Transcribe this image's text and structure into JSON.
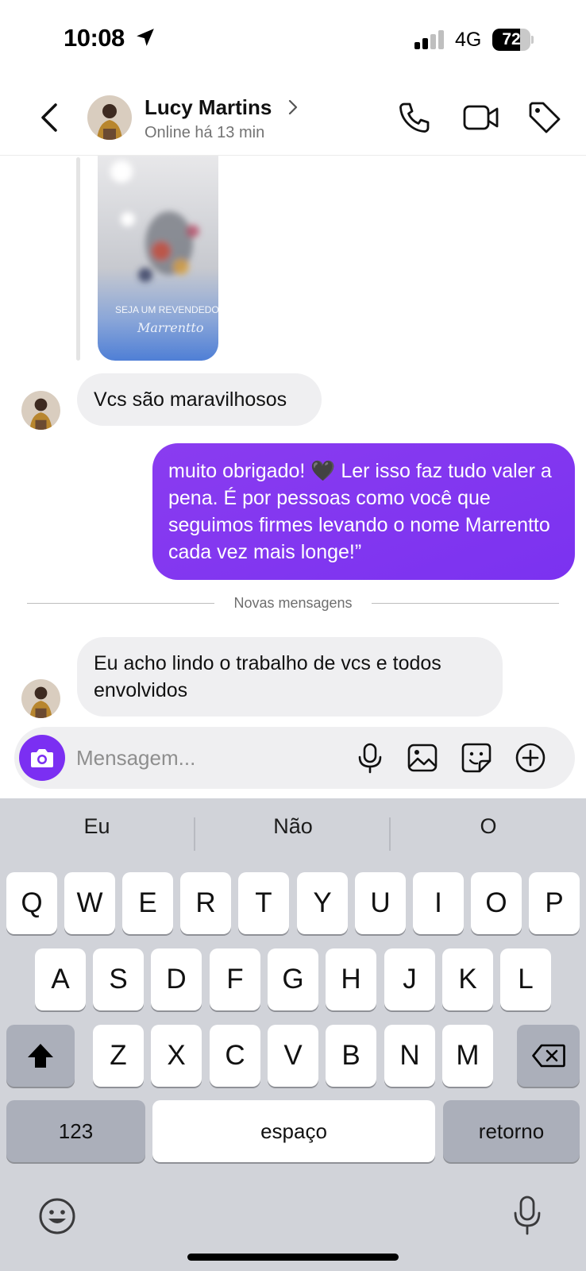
{
  "status_bar": {
    "time": "10:08",
    "network": "4G",
    "battery": "72",
    "battery_level": 0.72
  },
  "header": {
    "contact_name": "Lucy Martins",
    "contact_status": "Online há 13 min"
  },
  "shared_media": {
    "overlay_text": "SEJA UM REVENDEDOR",
    "brand_script": "Marrentto"
  },
  "messages": [
    {
      "direction": "incoming",
      "text": "Vcs são maravilhosos"
    },
    {
      "direction": "outgoing",
      "text": "muito obrigado! 🖤 Ler isso faz tudo valer a pena. É por pessoas como você que seguimos firmes levando o nome Marrentto cada vez mais longe!”"
    },
    {
      "direction": "incoming",
      "text": "Eu acho lindo o trabalho de vcs e todos envolvidos"
    }
  ],
  "new_messages_divider": "Novas mensagens",
  "composer": {
    "placeholder": "Mensagem..."
  },
  "keyboard": {
    "suggestions": [
      "Eu",
      "Não",
      "O"
    ],
    "row1": [
      "Q",
      "W",
      "E",
      "R",
      "T",
      "Y",
      "U",
      "I",
      "O",
      "P"
    ],
    "row2": [
      "A",
      "S",
      "D",
      "F",
      "G",
      "H",
      "J",
      "K",
      "L"
    ],
    "row3": [
      "Z",
      "X",
      "C",
      "V",
      "B",
      "N",
      "M"
    ],
    "numbers_key": "123",
    "space_key": "espaço",
    "return_key": "retorno"
  },
  "colors": {
    "accent": "#7b2ff2",
    "incoming_bubble": "#efeff1",
    "keyboard_bg": "#d1d3d9"
  }
}
